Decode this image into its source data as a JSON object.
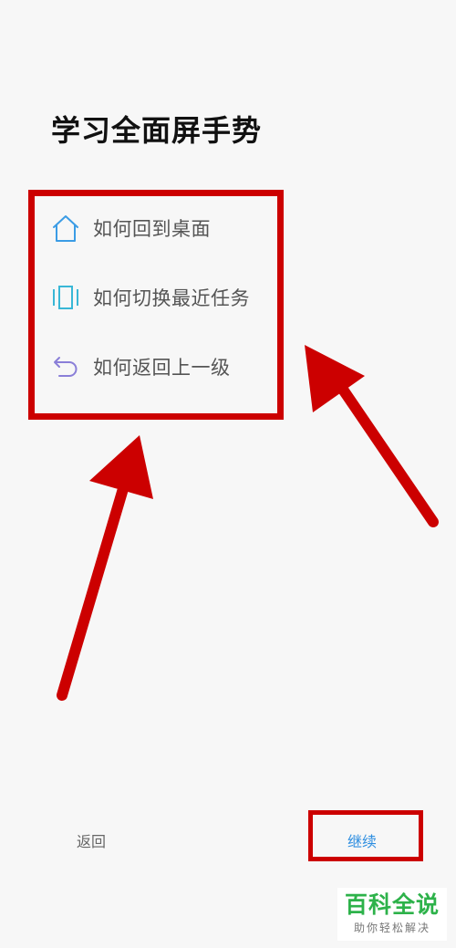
{
  "page": {
    "title": "学习全面屏手势"
  },
  "gestures": [
    {
      "icon": "home-icon",
      "label": "如何回到桌面"
    },
    {
      "icon": "recent-tasks-icon",
      "label": "如何切换最近任务"
    },
    {
      "icon": "back-arrow-icon",
      "label": "如何返回上一级"
    }
  ],
  "footer": {
    "back_label": "返回",
    "continue_label": "继续"
  },
  "watermark": {
    "title": "百科全说",
    "subtitle": "助你轻松解决"
  },
  "colors": {
    "annotation": "#cc0000",
    "accent": "#2e8ee0",
    "home_icon": "#3b9ce5",
    "recents_icon": "#39b7d6",
    "back_icon": "#8a7fd8",
    "watermark": "#2db24a"
  }
}
